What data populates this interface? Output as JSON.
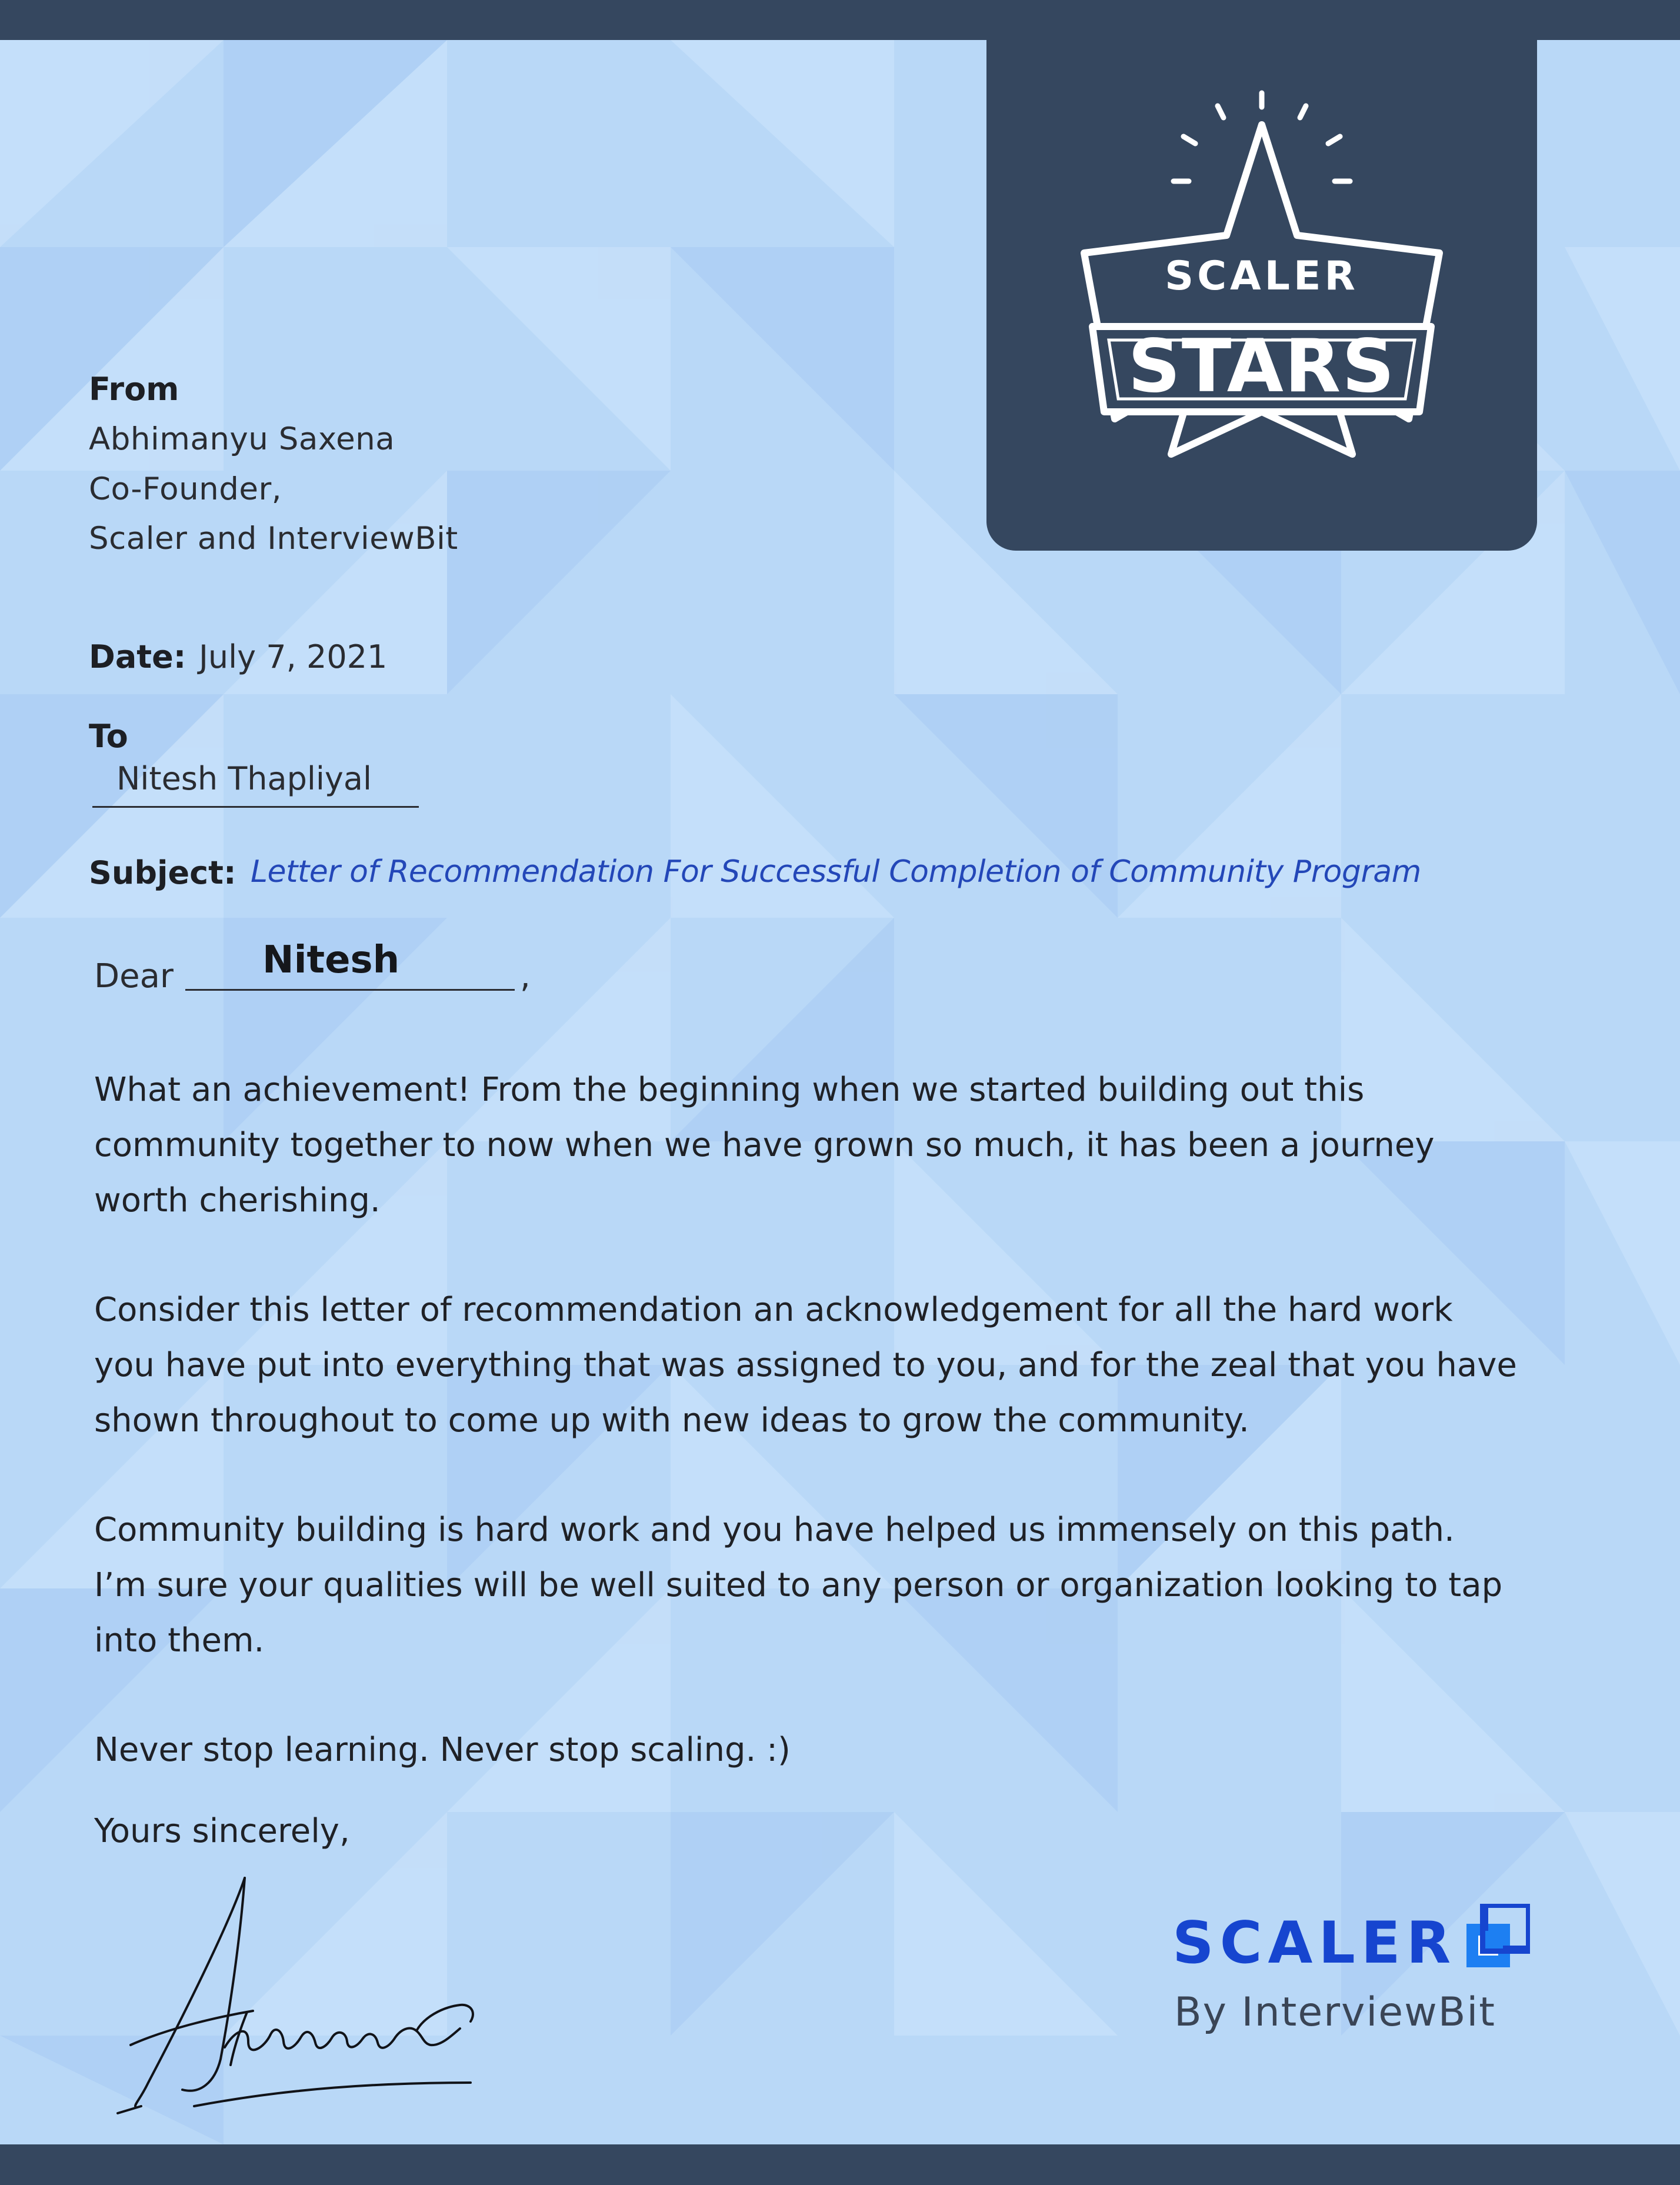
{
  "colors": {
    "background": "#b9d8f7",
    "bars": "#35475f",
    "subject": "#2347b8",
    "brand": "#1645cf"
  },
  "badge": {
    "line1": "SCALER",
    "line2": "STARS",
    "icon": "star-icon"
  },
  "from": {
    "label": "From",
    "name": "Abhimanyu Saxena",
    "title": "Co-Founder,",
    "org": "Scaler and InterviewBit"
  },
  "date": {
    "label": "Date:",
    "value": "July 7, 2021"
  },
  "to": {
    "label": "To",
    "name": "Nitesh Thapliyal"
  },
  "subject": {
    "label": "Subject:",
    "text": "Letter of Recommendation For Successful Completion of Community Program"
  },
  "salutation": {
    "dear": "Dear",
    "name": "Nitesh",
    "comma": ","
  },
  "body": {
    "p1": [
      "What an achievement! From the beginning when we started building out this",
      "community together to now when we have grown so much, it has been a journey",
      "worth cherishing."
    ],
    "p2": [
      "Consider this letter of recommendation an acknowledgement for all the hard work",
      "you have put into everything that was assigned to you, and for the zeal that you have",
      "shown throughout to come up with new ideas to grow the community."
    ],
    "p3": [
      "Community building is hard work and you have helped us immensely on this path.",
      "I’m sure your qualities will be well suited to any person or organization looking to tap",
      "into them."
    ],
    "p4": "Never stop learning. Never stop scaling. :)"
  },
  "closing": "Yours sincerely,",
  "signature": {
    "icon": "signature-icon"
  },
  "logo": {
    "word": "SCALER",
    "sub": "By InterviewBit",
    "icon": "scaler-logo-icon"
  }
}
